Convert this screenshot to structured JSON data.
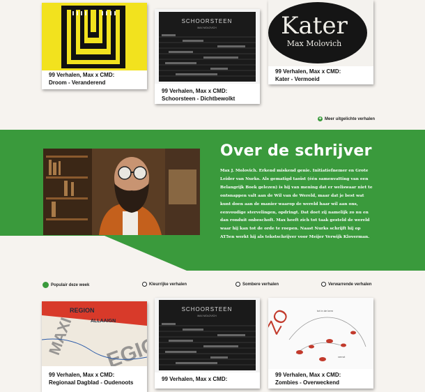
{
  "top_cards": [
    {
      "caption_line1": "99 Verhalen, Max x CMD:",
      "caption_line2": "Droom - Veranderend"
    },
    {
      "caption_line1": "99 Verhalen, Max x CMD:",
      "caption_line2": "Schoorsteen - Dichtbewolkt",
      "image_title": "SCHOORSTEEN",
      "image_sub": "MAX MOLOVICH"
    },
    {
      "caption_line1": "99 Verhalen, Max x CMD:",
      "caption_line2": "Kater - Vermoeid",
      "image_title": "Kater",
      "image_sub": "Max Molovich"
    }
  ],
  "more_link": "Meer uitgelichte verhalen",
  "about": {
    "title": "Over de schrijver",
    "lines": [
      "Max J. Molovich. Erkend miskend genie. Initiatiefnemer en Grote",
      "Leider van Nurks. Als gematigd taoïst (één samenvatting van een",
      "Belangrijk Boek gelezen) is hij van mening dat er weliswaar niet te",
      "ontsnappen valt aan de Wil van de Wereld, maar dat je best wat",
      "kunt doen aan de manier waarop de wereld haar wil aan ons,",
      "eenvoudige stervelingen, opdringt. Dat doet zij namelijk zo nu en",
      "dan ronduit onbeschoft. Max heeft zich tot taak gesteld de wereld",
      "waar hij kan tot de orde te roepen. Naast Nurks schrijft hij op",
      "AT5en werkt hij als tekstschrijver voor Meijer Verwijk Kloverman."
    ]
  },
  "filters": [
    {
      "label": "Populair deze week",
      "active": true
    },
    {
      "label": "Kleurrijke verhalen",
      "active": false
    },
    {
      "label": "Sombere verhalen",
      "active": false
    },
    {
      "label": "Verwarrende verhalen",
      "active": false
    }
  ],
  "bottom_cards": [
    {
      "caption_line1": "99 Verhalen, Max x CMD:",
      "caption_line2": "Regionaal Dagblad - Oudenoots"
    },
    {
      "caption_line1": "99 Verhalen, Max x CMD:",
      "caption_line2": "",
      "image_title": "SCHOORSTEEN",
      "image_sub": "MAX MOLOVICH"
    },
    {
      "caption_line1": "99 Verhalen, Max x CMD:",
      "caption_line2": "Zombies - Overweckend"
    }
  ],
  "colors": {
    "green": "#3a9a3c",
    "yellow": "#f2e21e",
    "background": "#f6f3ef"
  }
}
